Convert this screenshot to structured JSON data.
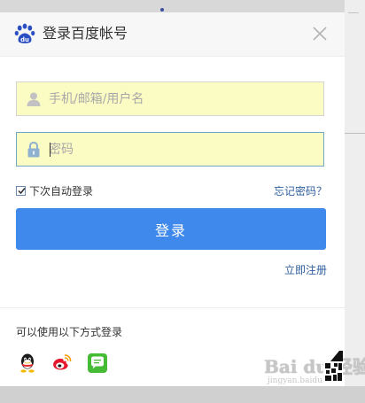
{
  "dialog": {
    "title": "登录百度帐号",
    "logo_icon": "baidu-paw-icon",
    "close_icon": "close-icon"
  },
  "form": {
    "username_placeholder": "手机/邮箱/用户名",
    "username_value": "",
    "username_icon": "user-icon",
    "password_placeholder": "密码",
    "password_value": "",
    "password_icon": "lock-icon",
    "remember_label": "下次自动登录",
    "remember_checked": true,
    "forgot_label": "忘记密码？",
    "login_label": "登录",
    "register_label": "立即注册"
  },
  "other": {
    "label": "可以使用以下方式登录",
    "providers": [
      {
        "name": "QQ",
        "icon": "qq-icon"
      },
      {
        "name": "微博",
        "icon": "weibo-icon"
      },
      {
        "name": "微信",
        "icon": "wechat-icon"
      }
    ]
  },
  "watermark": {
    "brand": "Bai du 经验",
    "url": "jingyan.baidu.com"
  },
  "colors": {
    "primary": "#3f89ec",
    "link": "#2e5e9e",
    "field_bg": "#fbfcc4",
    "focus_border": "#72a6c6"
  }
}
